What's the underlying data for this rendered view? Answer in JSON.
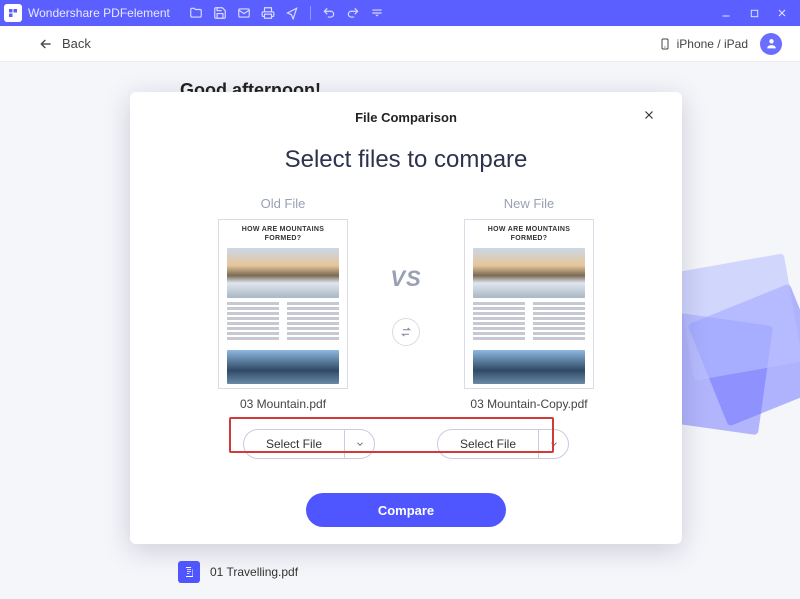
{
  "app": {
    "name": "Wondershare PDFelement"
  },
  "toolbar": {
    "back_label": "Back",
    "device_link": "iPhone / iPad"
  },
  "greeting": "Good afternoon!",
  "modal": {
    "title": "File Comparison",
    "heading": "Select files to compare",
    "old_label": "Old File",
    "new_label": "New File",
    "vs_label": "VS",
    "thumb_title": "HOW ARE MOUNTAINS FORMED?",
    "old_filename": "03 Mountain.pdf",
    "new_filename": "03 Mountain-Copy.pdf",
    "select_file_label": "Select File",
    "compare_label": "Compare"
  },
  "recent": {
    "item1": "01 Travelling.pdf"
  }
}
